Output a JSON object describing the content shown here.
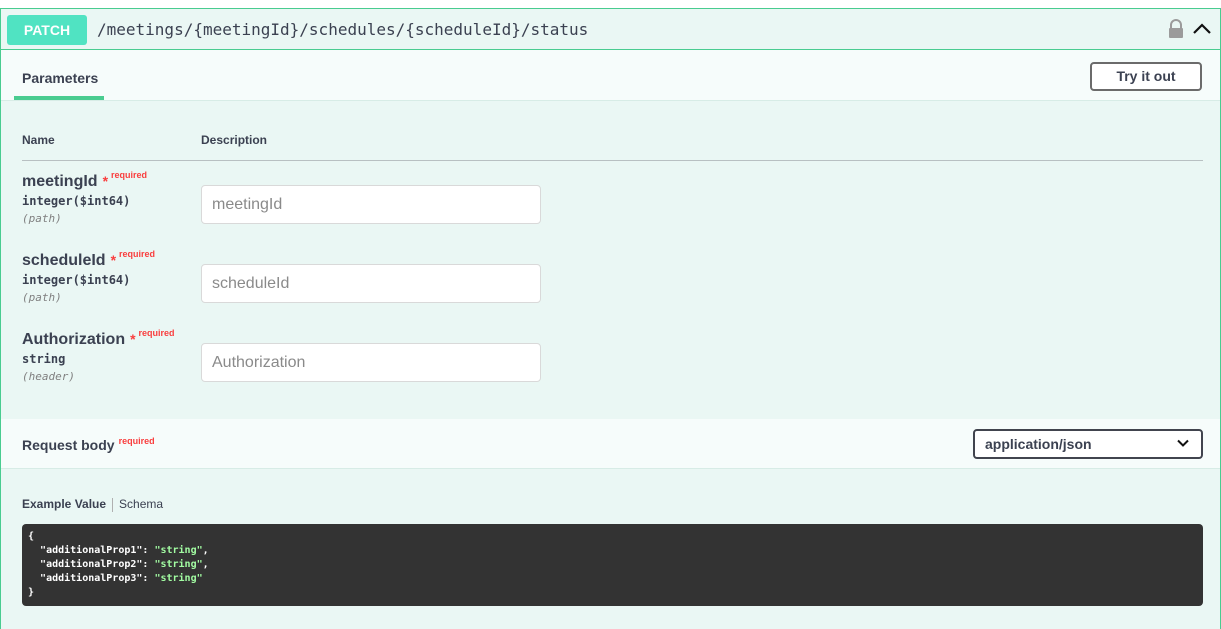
{
  "operation": {
    "method": "PATCH",
    "path": "/meetings/{meetingId}/schedules/{scheduleId}/status"
  },
  "tabs": {
    "parameters_label": "Parameters",
    "try_it_out_label": "Try it out"
  },
  "table": {
    "name_header": "Name",
    "description_header": "Description"
  },
  "parameters": [
    {
      "name": "meetingId",
      "star": "*",
      "required": "required",
      "type": "integer($int64)",
      "in": "(path)",
      "placeholder": "meetingId"
    },
    {
      "name": "scheduleId",
      "star": "*",
      "required": "required",
      "type": "integer($int64)",
      "in": "(path)",
      "placeholder": "scheduleId"
    },
    {
      "name": "Authorization",
      "star": "*",
      "required": "required",
      "type": "string",
      "in": "(header)",
      "placeholder": "Authorization"
    }
  ],
  "request_body": {
    "title": "Request body",
    "required": "required",
    "content_type": "application/json"
  },
  "example": {
    "value_tab": "Example Value",
    "schema_tab": "Schema",
    "open_brace": "{",
    "lines": [
      {
        "key": "\"additionalProp1\"",
        "value": "\"string\"",
        "sep": ","
      },
      {
        "key": "\"additionalProp2\"",
        "value": "\"string\"",
        "sep": ","
      },
      {
        "key": "\"additionalProp3\"",
        "value": "\"string\"",
        "sep": ""
      }
    ],
    "close_brace": "}"
  },
  "colors": {
    "accent": "#49cc90",
    "method_badge": "#50e3c2",
    "required": "#f93e3e",
    "code_bg": "#333333",
    "code_string": "#a2fca2"
  },
  "icons": {
    "lock": "lock-icon",
    "collapse": "chevron-up-icon",
    "dropdown": "chevron-down-icon"
  }
}
